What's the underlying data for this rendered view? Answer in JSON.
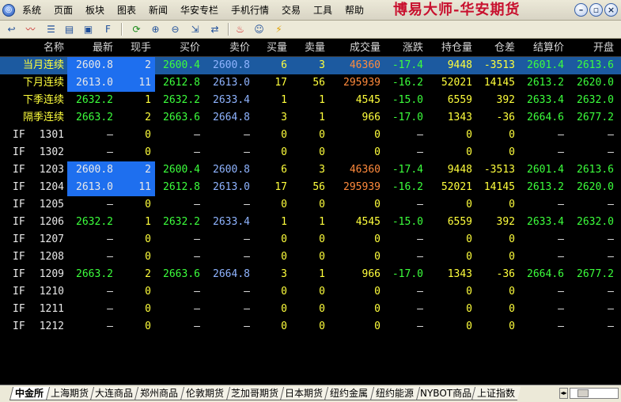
{
  "window_title": "博易大师-华安期货",
  "menu": [
    "系统",
    "页面",
    "板块",
    "图表",
    "新闻",
    "华安专栏",
    "手机行情",
    "交易",
    "工具",
    "帮助"
  ],
  "window_buttons": [
    "minimize",
    "restore",
    "close"
  ],
  "toolbar_icons": [
    "back-icon",
    "line-chart-icon",
    "quote-list-icon",
    "detail-list-icon",
    "window-icon",
    "f10-icon",
    "refresh-icon",
    "zoom-in-icon",
    "zoom-out-icon",
    "export-icon",
    "switch-icon",
    "alarm-icon",
    "user-icon",
    "flash-icon"
  ],
  "columns": [
    "名称",
    "最新",
    "现手",
    "买价",
    "卖价",
    "买量",
    "卖量",
    "成交量",
    "涨跌",
    "持仓量",
    "仓差",
    "结算价",
    "开盘"
  ],
  "rows": [
    {
      "code": "",
      "name": "当月连续",
      "last": "2600.8",
      "hand": "2",
      "bid": "2600.4",
      "ask": "2600.8",
      "bidvol": "6",
      "askvol": "3",
      "volume": "46360",
      "change": "-17.4",
      "oi": "9448",
      "oichg": "-3513",
      "settle": "2601.4",
      "open": "2613.6"
    },
    {
      "code": "",
      "name": "下月连续",
      "last": "2613.0",
      "hand": "11",
      "bid": "2612.8",
      "ask": "2613.0",
      "bidvol": "17",
      "askvol": "56",
      "volume": "295939",
      "change": "-16.2",
      "oi": "52021",
      "oichg": "14145",
      "settle": "2613.2",
      "open": "2620.0"
    },
    {
      "code": "",
      "name": "下季连续",
      "last": "2632.2",
      "hand": "1",
      "bid": "2632.2",
      "ask": "2633.4",
      "bidvol": "1",
      "askvol": "1",
      "volume": "4545",
      "change": "-15.0",
      "oi": "6559",
      "oichg": "392",
      "settle": "2633.4",
      "open": "2632.0"
    },
    {
      "code": "",
      "name": "隔季连续",
      "last": "2663.2",
      "hand": "2",
      "bid": "2663.6",
      "ask": "2664.8",
      "bidvol": "3",
      "askvol": "1",
      "volume": "966",
      "change": "-17.0",
      "oi": "1343",
      "oichg": "-36",
      "settle": "2664.6",
      "open": "2677.2"
    },
    {
      "code": "IF",
      "name": "1301",
      "last": "—",
      "hand": "0",
      "bid": "—",
      "ask": "—",
      "bidvol": "0",
      "askvol": "0",
      "volume": "0",
      "change": "—",
      "oi": "0",
      "oichg": "0",
      "settle": "—",
      "open": "—"
    },
    {
      "code": "IF",
      "name": "1302",
      "last": "—",
      "hand": "0",
      "bid": "—",
      "ask": "—",
      "bidvol": "0",
      "askvol": "0",
      "volume": "0",
      "change": "—",
      "oi": "0",
      "oichg": "0",
      "settle": "—",
      "open": "—"
    },
    {
      "code": "IF",
      "name": "1203",
      "last": "2600.8",
      "hand": "2",
      "bid": "2600.4",
      "ask": "2600.8",
      "bidvol": "6",
      "askvol": "3",
      "volume": "46360",
      "change": "-17.4",
      "oi": "9448",
      "oichg": "-3513",
      "settle": "2601.4",
      "open": "2613.6"
    },
    {
      "code": "IF",
      "name": "1204",
      "last": "2613.0",
      "hand": "11",
      "bid": "2612.8",
      "ask": "2613.0",
      "bidvol": "17",
      "askvol": "56",
      "volume": "295939",
      "change": "-16.2",
      "oi": "52021",
      "oichg": "14145",
      "settle": "2613.2",
      "open": "2620.0"
    },
    {
      "code": "IF",
      "name": "1205",
      "last": "—",
      "hand": "0",
      "bid": "—",
      "ask": "—",
      "bidvol": "0",
      "askvol": "0",
      "volume": "0",
      "change": "—",
      "oi": "0",
      "oichg": "0",
      "settle": "—",
      "open": "—"
    },
    {
      "code": "IF",
      "name": "1206",
      "last": "2632.2",
      "hand": "1",
      "bid": "2632.2",
      "ask": "2633.4",
      "bidvol": "1",
      "askvol": "1",
      "volume": "4545",
      "change": "-15.0",
      "oi": "6559",
      "oichg": "392",
      "settle": "2633.4",
      "open": "2632.0"
    },
    {
      "code": "IF",
      "name": "1207",
      "last": "—",
      "hand": "0",
      "bid": "—",
      "ask": "—",
      "bidvol": "0",
      "askvol": "0",
      "volume": "0",
      "change": "—",
      "oi": "0",
      "oichg": "0",
      "settle": "—",
      "open": "—"
    },
    {
      "code": "IF",
      "name": "1208",
      "last": "—",
      "hand": "0",
      "bid": "—",
      "ask": "—",
      "bidvol": "0",
      "askvol": "0",
      "volume": "0",
      "change": "—",
      "oi": "0",
      "oichg": "0",
      "settle": "—",
      "open": "—"
    },
    {
      "code": "IF",
      "name": "1209",
      "last": "2663.2",
      "hand": "2",
      "bid": "2663.6",
      "ask": "2664.8",
      "bidvol": "3",
      "askvol": "1",
      "volume": "966",
      "change": "-17.0",
      "oi": "1343",
      "oichg": "-36",
      "settle": "2664.6",
      "open": "2677.2"
    },
    {
      "code": "IF",
      "name": "1210",
      "last": "—",
      "hand": "0",
      "bid": "—",
      "ask": "—",
      "bidvol": "0",
      "askvol": "0",
      "volume": "0",
      "change": "—",
      "oi": "0",
      "oichg": "0",
      "settle": "—",
      "open": "—"
    },
    {
      "code": "IF",
      "name": "1211",
      "last": "—",
      "hand": "0",
      "bid": "—",
      "ask": "—",
      "bidvol": "0",
      "askvol": "0",
      "volume": "0",
      "change": "—",
      "oi": "0",
      "oichg": "0",
      "settle": "—",
      "open": "—"
    },
    {
      "code": "IF",
      "name": "1212",
      "last": "—",
      "hand": "0",
      "bid": "—",
      "ask": "—",
      "bidvol": "0",
      "askvol": "0",
      "volume": "0",
      "change": "—",
      "oi": "0",
      "oichg": "0",
      "settle": "—",
      "open": "—"
    }
  ],
  "selected_row": 0,
  "highlighted_rows": [
    0,
    1,
    6,
    7
  ],
  "market_tabs": [
    "中金所",
    "上海期货",
    "大连商品",
    "郑州商品",
    "伦敦期货",
    "芝加哥期货",
    "日本期货",
    "纽约金属",
    "纽约能源",
    "NYBOT商品",
    "上证指数"
  ],
  "active_tab": 0,
  "colors": {
    "accent_title": "#c8102e",
    "highlight": "#1e6fef",
    "selected_row": "#1c5aa0",
    "up": "#ff4040",
    "down": "#3cff3c",
    "name": "#ffff3c"
  }
}
